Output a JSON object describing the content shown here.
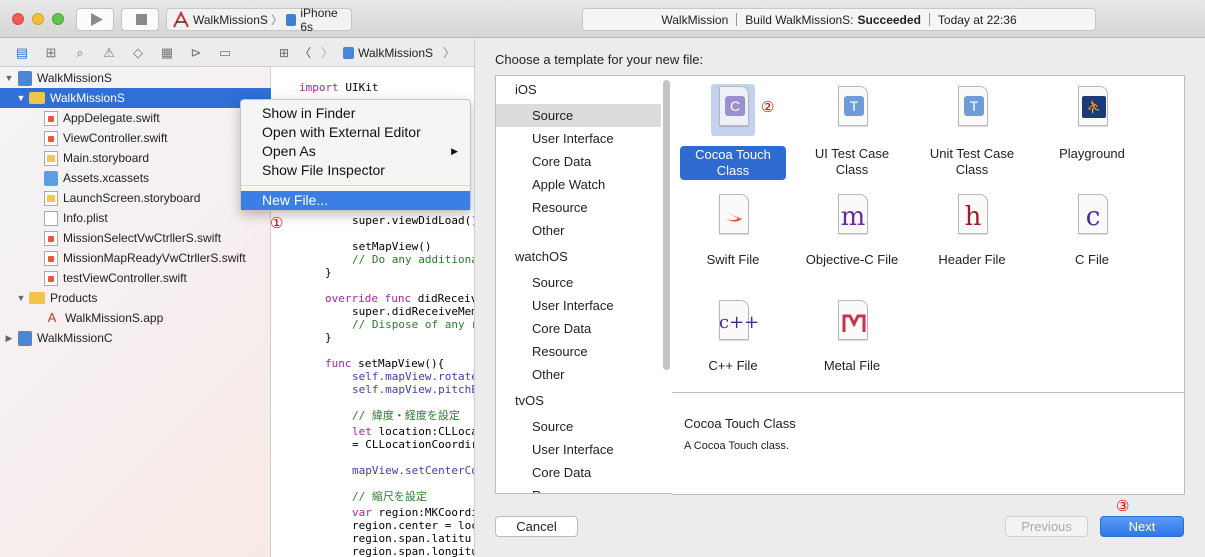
{
  "toolbar": {
    "scheme": "WalkMissionS",
    "device": "iPhone 6s",
    "status_project": "WalkMission",
    "status_build": "Build WalkMissionS:",
    "status_result": "Succeeded",
    "status_time": "Today at 22:36"
  },
  "navigator": {
    "items": [
      {
        "label": "WalkMissionS"
      },
      {
        "label": "WalkMissionS"
      },
      {
        "label": "AppDelegate.swift"
      },
      {
        "label": "ViewController.swift"
      },
      {
        "label": "Main.storyboard"
      },
      {
        "label": "Assets.xcassets"
      },
      {
        "label": "LaunchScreen.storyboard"
      },
      {
        "label": "Info.plist"
      },
      {
        "label": "MissionSelectVwCtrllerS.swift"
      },
      {
        "label": "MissionMapReadyVwCtrllerS.swift"
      },
      {
        "label": "testViewController.swift"
      },
      {
        "label": "Products"
      },
      {
        "label": "WalkMissionS.app"
      },
      {
        "label": "WalkMissionC"
      }
    ]
  },
  "editor": {
    "breadcrumb": "WalkMissionS",
    "code": {
      "l1_kw": "import",
      "l1_rest": " UIKit",
      "l2": "super.viewDidLoad()",
      "l3": "setMapView()",
      "l4": "// Do any additiona",
      "l5": "}",
      "l6_kw": "override func",
      "l6_rest": " didReceive",
      "l7": "super.didReceiveMem",
      "l8": "// Dispose of any r",
      "l9": "}",
      "l10_kw": "func",
      "l10_rest": " setMapView(){",
      "l11": "self.mapView.rotate",
      "l12": "self.mapView.pitchE",
      "l13": "// 緯度・経度を設定",
      "l14_kw": "let",
      "l14_rest": " location:CLLoca",
      "l15": "= CLLocationCoordir",
      "l16": "mapView.setCenterCo",
      "l17": "// 縮尺を設定",
      "l18_kw": "var",
      "l18_rest": " region:MKCoordi",
      "l19": "region.center = loc",
      "l20": "region.span.latitu",
      "l21": "region.span.longitu"
    }
  },
  "context_menu": {
    "items": [
      "Show in Finder",
      "Open with External Editor",
      "Open As",
      "Show File Inspector"
    ],
    "new_file": "New File...",
    "marker": "①"
  },
  "dialog": {
    "title": "Choose a template for your new file:",
    "platforms": [
      {
        "header": "iOS",
        "items": [
          "Source",
          "User Interface",
          "Core Data",
          "Apple Watch",
          "Resource",
          "Other"
        ]
      },
      {
        "header": "watchOS",
        "items": [
          "Source",
          "User Interface",
          "Core Data",
          "Resource",
          "Other"
        ]
      },
      {
        "header": "tvOS",
        "items": [
          "Source",
          "User Interface",
          "Core Data",
          "Resource"
        ]
      }
    ],
    "templates": [
      {
        "label": "Cocoa Touch Class",
        "icon": "cocoa-touch-class-icon"
      },
      {
        "label": "UI Test Case Class",
        "icon": "ui-test-case-icon"
      },
      {
        "label": "Unit Test Case Class",
        "icon": "unit-test-case-icon"
      },
      {
        "label": "Playground",
        "icon": "playground-icon"
      },
      {
        "label": "Swift File",
        "icon": "swift-file-icon"
      },
      {
        "label": "Objective-C File",
        "icon": "objc-file-icon"
      },
      {
        "label": "Header File",
        "icon": "header-file-icon"
      },
      {
        "label": "C File",
        "icon": "c-file-icon"
      },
      {
        "label": "C++ File",
        "icon": "cpp-file-icon"
      },
      {
        "label": "Metal File",
        "icon": "metal-file-icon"
      }
    ],
    "selected_marker": "②",
    "description_title": "Cocoa Touch Class",
    "description_text": "A Cocoa Touch class.",
    "cancel": "Cancel",
    "previous": "Previous",
    "next": "Next",
    "next_marker": "③"
  },
  "colors": {
    "selection": "#2f6fd6",
    "accent": "#3a7ee6",
    "marker": "#ee0000"
  }
}
